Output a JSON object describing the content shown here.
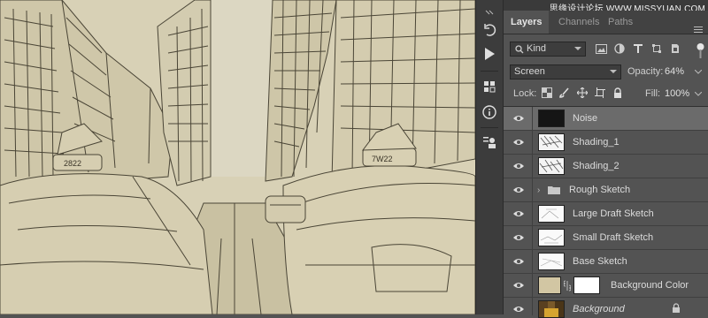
{
  "colors": {
    "panel_bg": "#535353",
    "tab_bar": "#424242",
    "selected_row": "#6b6b6b",
    "canvas_paper": "#d8d1b6",
    "swatch_beige": "#d2c6a3"
  },
  "watermark": "思缘设计论坛 WWW.MISSYUAN.COM",
  "tabs": [
    {
      "label": "Layers"
    },
    {
      "label": "Channels"
    },
    {
      "label": "Paths"
    }
  ],
  "filter": {
    "kind_label": "Kind",
    "icons": [
      "image-filter-icon",
      "adjustment-filter-icon",
      "type-filter-icon",
      "shape-filter-icon",
      "smart-object-filter-icon"
    ]
  },
  "blend": {
    "mode": "Screen",
    "opacity_label": "Opacity:",
    "opacity": "64%"
  },
  "lock": {
    "label": "Lock:",
    "fill_label": "Fill:",
    "fill": "100%"
  },
  "layers": [
    {
      "name": "Noise",
      "selected": true
    },
    {
      "name": "Shading_1"
    },
    {
      "name": "Shading_2"
    },
    {
      "name": "Rough Sketch",
      "group": true
    },
    {
      "name": "Large Draft Sketch"
    },
    {
      "name": "Small Draft Sketch"
    },
    {
      "name": "Base Sketch"
    },
    {
      "name": "Background Color",
      "adjustment": true
    },
    {
      "name": "Background",
      "locked": true
    }
  ],
  "tools": [
    "history-icon",
    "play-icon",
    "3d-icon",
    "info-icon",
    "clone-source-icon"
  ]
}
